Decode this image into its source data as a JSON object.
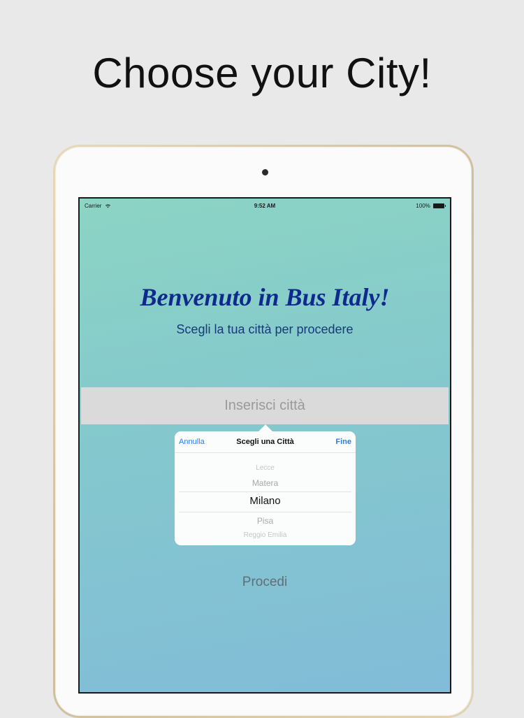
{
  "headline": "Choose your City!",
  "status_bar": {
    "carrier": "Carrier",
    "time": "9:52 AM",
    "battery": "100%"
  },
  "welcome": {
    "title": "Benvenuto in Bus Italy!",
    "subtitle": "Scegli la tua città per procedere"
  },
  "city_input": {
    "placeholder": "Inserisci città"
  },
  "picker": {
    "cancel_label": "Annulla",
    "title": "Scegli una Città",
    "done_label": "Fine",
    "options": [
      "Lecce",
      "Matera",
      "Milano",
      "Pisa",
      "Reggio Emilia"
    ],
    "selected": "Milano"
  },
  "proceed_label": "Procedi",
  "colors": {
    "title": "#0e2a8c",
    "accent": "#2a7ee0",
    "screen_top": "#8cd4c4",
    "screen_bottom": "#82bcd8"
  }
}
